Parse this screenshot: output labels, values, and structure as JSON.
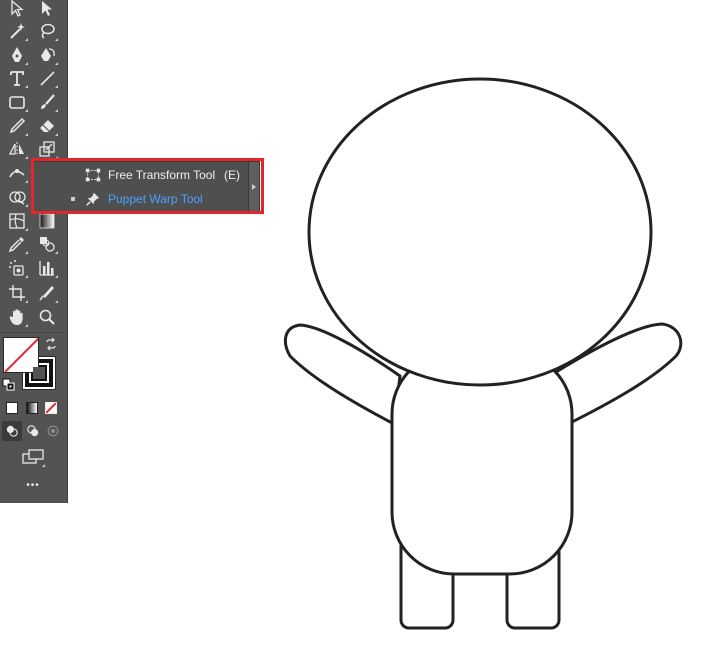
{
  "toolbar": {
    "more_label": "•••"
  },
  "flyout": {
    "items": [
      {
        "label": "Free Transform Tool",
        "shortcut": "(E)",
        "icon": "free-transform-icon",
        "current": false
      },
      {
        "label": "Puppet Warp Tool",
        "shortcut": "",
        "icon": "puppet-warp-icon",
        "current": true
      }
    ]
  },
  "colors": {
    "toolbar_bg": "#535353",
    "highlight": "#e3262e",
    "selected_text": "#4aa3ff",
    "artwork_stroke": "#222222"
  }
}
